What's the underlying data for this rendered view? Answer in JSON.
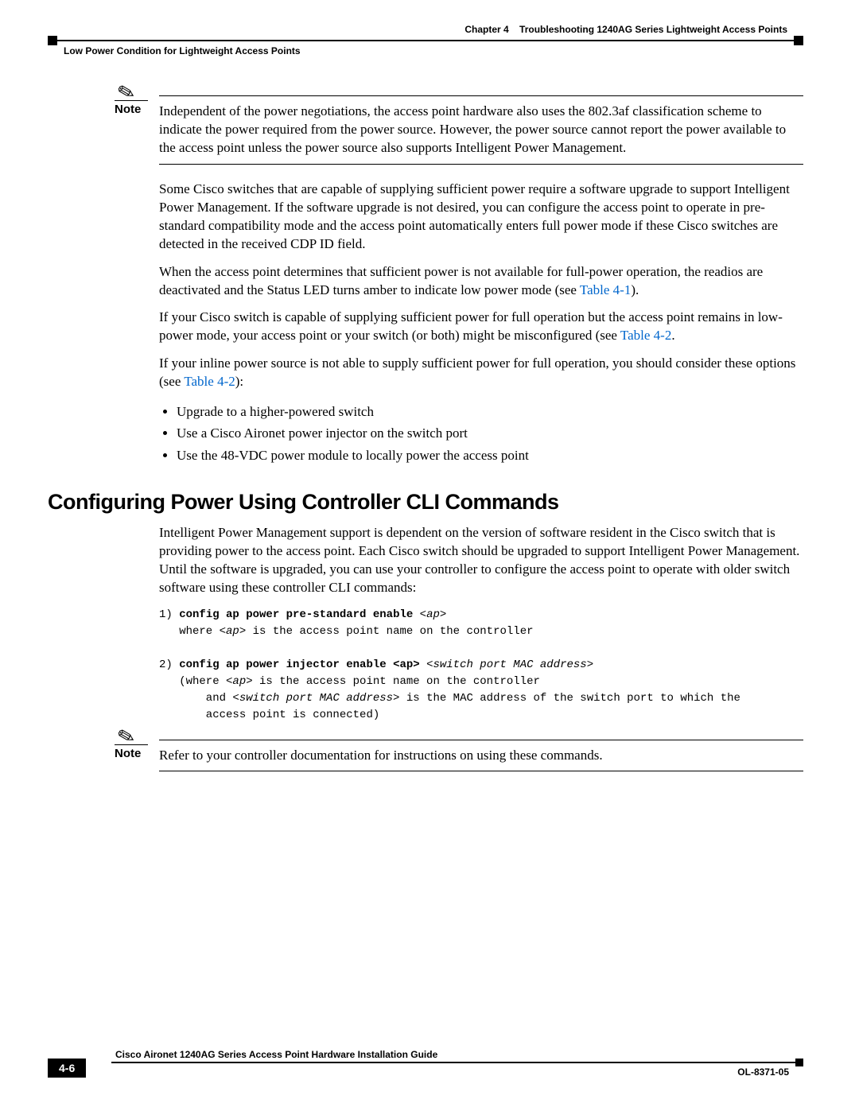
{
  "header": {
    "chapter_label": "Chapter 4",
    "chapter_title": "Troubleshooting 1240AG Series Lightweight Access Points",
    "section": "Low Power Condition for Lightweight Access Points"
  },
  "note1": {
    "label": "Note",
    "text": "Independent of the power negotiations, the access point hardware also uses the 802.3af classification scheme to indicate the power required from the power source. However, the power source cannot report the power available to the access point unless the power source also supports Intelligent Power Management."
  },
  "para1": "Some Cisco switches that are capable of supplying sufficient power require a software upgrade to support Intelligent Power Management. If the software upgrade is not desired, you can configure the access point to operate in pre-standard compatibility mode and the access point automatically enters full power mode if these Cisco switches are detected in the received CDP ID field.",
  "para2_pre": "When the access point determines that sufficient power is not available for full-power operation, the readios are deactivated and the Status LED turns amber to indicate low power mode (see ",
  "para2_link": "Table 4-1",
  "para2_post": ").",
  "para3_pre": "If your Cisco switch is capable of supplying sufficient power for full operation but the access point remains in low-power mode, your access point or your switch (or both) might be misconfigured (see ",
  "para3_link": "Table 4-2",
  "para3_post": ".",
  "para4_pre": "If your inline power source is not able to supply sufficient power for full operation, you should consider these options (see ",
  "para4_link": "Table 4-2",
  "para4_post": "):",
  "bullets": {
    "b1": "Upgrade to a higher-powered switch",
    "b2": "Use a Cisco Aironet power injector on the switch port",
    "b3": "Use the 48-VDC power module to locally power the access point"
  },
  "h2": "Configuring Power Using Controller CLI Commands",
  "para5": "Intelligent Power Management support is dependent on the version of software resident in the Cisco switch that is providing power to the access point. Each Cisco switch should be upgraded to support Intelligent Power Management. Until the software is upgraded, you can use your controller to configure the access point to operate with older switch software using these controller CLI commands:",
  "cli": {
    "line1_num": "1) ",
    "line1_bold": "config ap power pre-standard enable ",
    "line1_arg": "<ap>",
    "line1_where": "   where ",
    "line1_where_arg": "<ap>",
    "line1_where_rest": " is the access point name on the controller",
    "line2_num": "2) ",
    "line2_bold": "config ap power injector enable <ap> ",
    "line2_arg": "<switch port MAC address>",
    "line2_where": "   (where ",
    "line2_where_arg": "<ap>",
    "line2_where_rest": " is the access point name on the controller",
    "line2_and": "       and ",
    "line2_and_arg": "<switch port MAC address>",
    "line2_and_rest": " is the MAC address of the switch port to which the",
    "line2_last": "       access point is connected)"
  },
  "note2": {
    "label": "Note",
    "text": "Refer to your controller documentation for instructions on using these commands."
  },
  "footer": {
    "title": "Cisco Aironet 1240AG Series Access Point Hardware Installation Guide",
    "page": "4-6",
    "docnum": "OL-8371-05"
  }
}
